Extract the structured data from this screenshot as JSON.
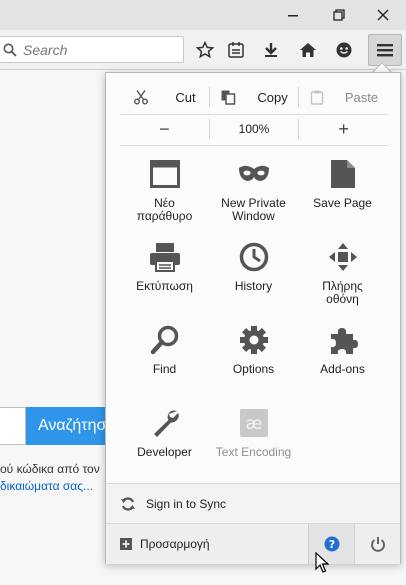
{
  "toolbar": {
    "search_placeholder": "Search"
  },
  "page": {
    "button_label": "Αναζήτηση",
    "text_line": "ού κώδικα από τον",
    "link_line": "δικαιώματα σας..."
  },
  "menu": {
    "edit": {
      "cut": "Cut",
      "copy": "Copy",
      "paste": "Paste"
    },
    "zoom": {
      "minus": "−",
      "value": "100%",
      "plus": "+"
    },
    "tiles": [
      {
        "label": "Νέο\nπαράθυρο",
        "icon": "new-window-icon"
      },
      {
        "label": "New Private\nWindow",
        "icon": "private-mask-icon"
      },
      {
        "label": "Save Page",
        "icon": "save-page-icon"
      },
      {
        "label": "Εκτύπωση",
        "icon": "printer-icon"
      },
      {
        "label": "History",
        "icon": "clock-icon"
      },
      {
        "label": "Πλήρης\nοθόνη",
        "icon": "fullscreen-icon"
      },
      {
        "label": "Find",
        "icon": "magnifier-icon"
      },
      {
        "label": "Options",
        "icon": "gear-icon"
      },
      {
        "label": "Add-ons",
        "icon": "puzzle-icon"
      },
      {
        "label": "Developer",
        "icon": "wrench-icon"
      },
      {
        "label": "Text Encoding",
        "icon": "text-encoding-icon",
        "disabled": true
      }
    ],
    "sync_label": "Sign in to Sync",
    "customize_label": "Προσαρμογή"
  },
  "colors": {
    "accent": "#2e95e8",
    "help_blue": "#1f6fd6",
    "icon_gray": "#555555"
  }
}
